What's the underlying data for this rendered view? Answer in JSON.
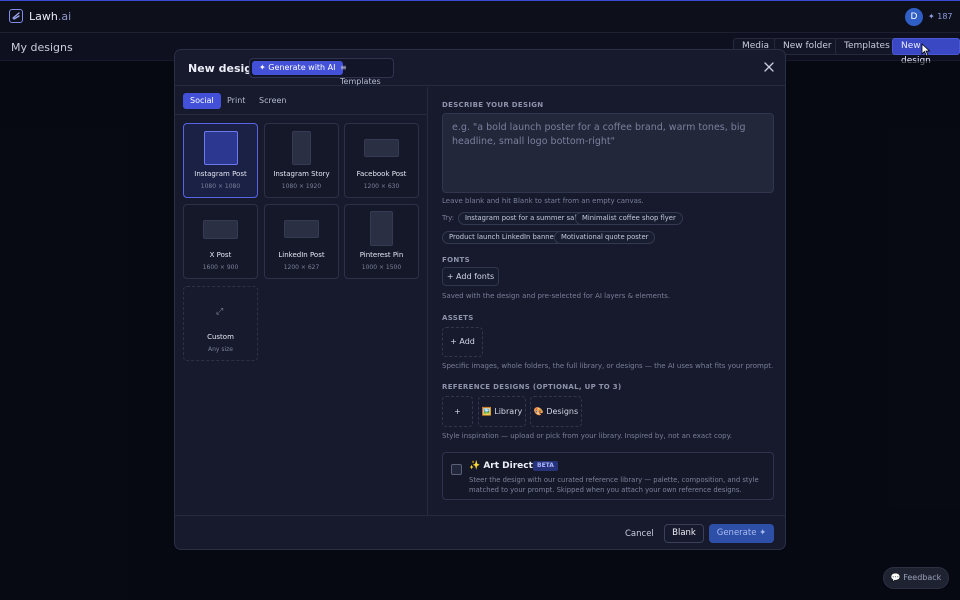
{
  "topbar": {
    "brand_main": "Lawh",
    "brand_suffix": ".ai",
    "avatar_initial": "D",
    "credits": "✦ 187"
  },
  "subbar": {
    "title": "My designs",
    "buttons": [
      "Media",
      "New folder",
      "Templates",
      "New design"
    ]
  },
  "modal": {
    "title": "New design",
    "mode_generate": "✦ Generate with AI",
    "mode_templates": "≡ Templates",
    "category_tabs": [
      "Social",
      "Print",
      "Screen"
    ],
    "formats": [
      {
        "name": "Instagram Post",
        "size": "1080 × 1080"
      },
      {
        "name": "Instagram Story",
        "size": "1080 × 1920"
      },
      {
        "name": "Facebook Post",
        "size": "1200 × 630"
      },
      {
        "name": "X Post",
        "size": "1600 × 900"
      },
      {
        "name": "LinkedIn Post",
        "size": "1200 × 627"
      },
      {
        "name": "Pinterest Pin",
        "size": "1000 × 1500"
      },
      {
        "name": "Custom",
        "size": "Any size"
      }
    ],
    "describe": {
      "label": "DESCRIBE YOUR DESIGN",
      "placeholder": "e.g. \"a bold launch poster for a coffee brand, warm tones, big headline, small logo bottom-right\"",
      "hint": "Leave blank and hit Blank to start from an empty canvas.",
      "try_label": "Try:",
      "suggestions": [
        "Instagram post for a summer sale",
        "Minimalist coffee shop flyer",
        "Product launch LinkedIn banner",
        "Motivational quote poster"
      ]
    },
    "fonts": {
      "label": "FONTS",
      "button": "+ Add fonts",
      "hint": "Saved with the design and pre-selected for AI layers & elements."
    },
    "assets": {
      "label": "ASSETS",
      "button": "+ Add",
      "hint": "Specific images, whole folders, the full library, or designs — the AI uses what fits your prompt."
    },
    "references": {
      "label": "REFERENCE DESIGNS (OPTIONAL, UP TO 3)",
      "add": "+",
      "library": "🖼️ Library",
      "designs": "🎨 Designs",
      "hint": "Style inspiration — upload or pick from your library. Inspired by, not an exact copy."
    },
    "art_director": {
      "title": "✨ Art Director",
      "badge": "BETA",
      "description": "Steer the design with our curated reference library — palette, composition, and style matched to your prompt. Skipped when you attach your own reference designs."
    },
    "footer": {
      "cancel": "Cancel",
      "blank": "Blank",
      "generate": "Generate ✦"
    }
  },
  "feedback": "💬 Feedback"
}
